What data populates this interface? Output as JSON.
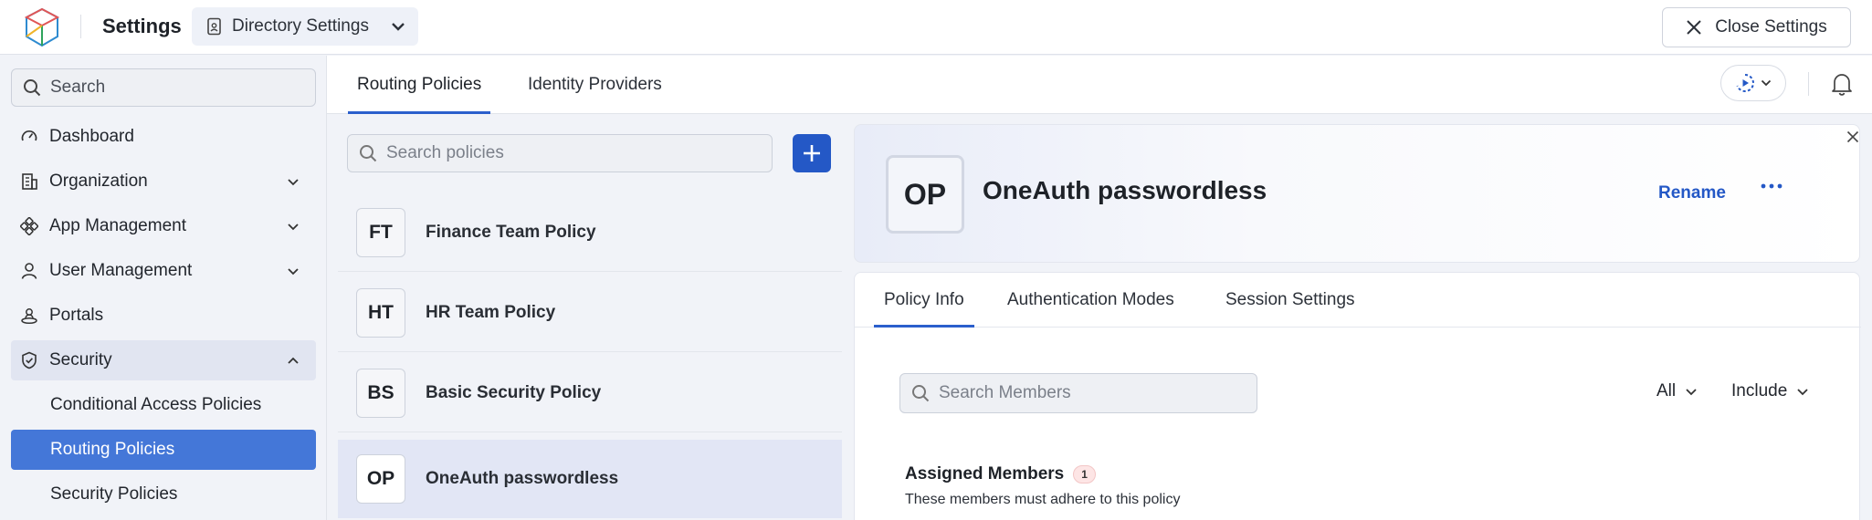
{
  "topbar": {
    "app_title": "Settings",
    "directory_dropdown": "Directory Settings",
    "close_label": "Close Settings"
  },
  "sidebar": {
    "search_placeholder": "Search",
    "items": [
      {
        "label": "Dashboard",
        "icon": "gauge-icon"
      },
      {
        "label": "Organization",
        "icon": "building-icon"
      },
      {
        "label": "App Management",
        "icon": "apps-icon"
      },
      {
        "label": "User Management",
        "icon": "user-icon"
      },
      {
        "label": "Portals",
        "icon": "portal-icon"
      },
      {
        "label": "Security",
        "icon": "shield-icon"
      }
    ],
    "security_sub_items": [
      {
        "label": "Conditional Access Policies"
      },
      {
        "label": "Routing Policies"
      },
      {
        "label": "Security Policies"
      }
    ]
  },
  "main_tabs": {
    "tab1": "Routing Policies",
    "tab2": "Identity Providers"
  },
  "policy_list": {
    "search_placeholder": "Search policies",
    "policies": [
      {
        "initials": "FT",
        "name": "Finance Team Policy"
      },
      {
        "initials": "HT",
        "name": "HR Team Policy"
      },
      {
        "initials": "BS",
        "name": "Basic Security Policy"
      },
      {
        "initials": "OP",
        "name": "OneAuth passwordless"
      }
    ]
  },
  "detail": {
    "initials": "OP",
    "title": "OneAuth passwordless",
    "rename_label": "Rename",
    "tabs": {
      "policy_info": "Policy Info",
      "auth_modes": "Authentication Modes",
      "session": "Session Settings"
    },
    "members_search_placeholder": "Search Members",
    "filter_scope": "All",
    "filter_mode": "Include",
    "assigned_title": "Assigned Members",
    "assigned_count": "1",
    "assigned_subtitle": "These members must adhere to this policy"
  },
  "colors": {
    "accent": "#2458c6",
    "active_nav": "#4477d8"
  }
}
